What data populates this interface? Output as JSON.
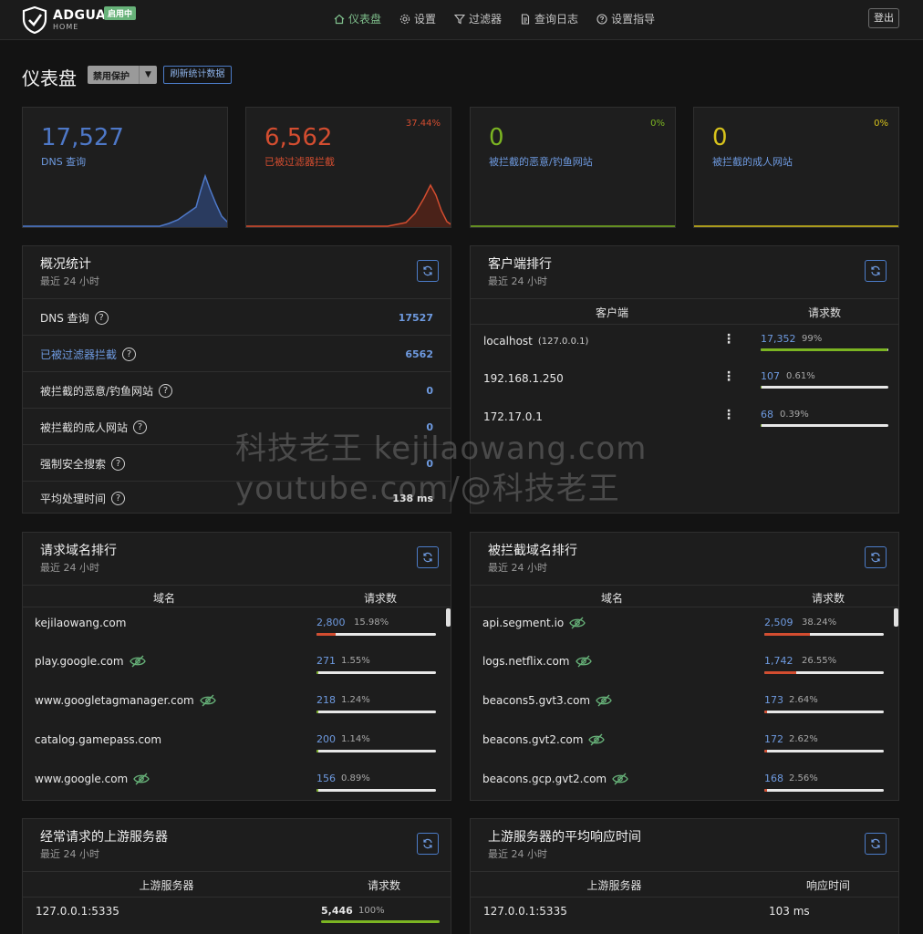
{
  "header": {
    "brand": "ADGUARD",
    "brand_sub": "HOME",
    "status_badge": "启用中",
    "nav": [
      {
        "label": "仪表盘",
        "icon": "home-icon"
      },
      {
        "label": "设置",
        "icon": "gear-icon"
      },
      {
        "label": "过滤器",
        "icon": "filter-icon"
      },
      {
        "label": "查询日志",
        "icon": "document-icon"
      },
      {
        "label": "设置指导",
        "icon": "help-icon"
      }
    ],
    "logout": "登出"
  },
  "page": {
    "title": "仪表盘",
    "toggle_protection": "禁用保护",
    "refresh_stats": "刷新统计数据"
  },
  "stats": [
    {
      "value": "17,527",
      "label": "DNS 查询",
      "percent": "",
      "color": "#4e78c8"
    },
    {
      "value": "6,562",
      "label": "已被过滤器拦截",
      "percent": "37.44%",
      "color": "#d34d30"
    },
    {
      "value": "0",
      "label": "被拦截的恶意/钓鱼网站",
      "percent": "0%",
      "color": "#7bb422"
    },
    {
      "value": "0",
      "label": "被拦截的成人网站",
      "percent": "0%",
      "color": "#d8c31c"
    }
  ],
  "overview": {
    "title": "概况统计",
    "subtitle": "最近 24 小时",
    "rows": [
      {
        "label": "DNS 查询",
        "value": "17527"
      },
      {
        "label": "已被过滤器拦截",
        "value": "6562"
      },
      {
        "label": "被拦截的恶意/钓鱼网站",
        "value": "0"
      },
      {
        "label": "被拦截的成人网站",
        "value": "0"
      },
      {
        "label": "强制安全搜索",
        "value": "0"
      },
      {
        "label": "平均处理时间",
        "value": "138 ms"
      }
    ]
  },
  "clients": {
    "title": "客户端排行",
    "subtitle": "最近 24 小时",
    "col_client": "客户端",
    "col_requests": "请求数",
    "rows": [
      {
        "name": "localhost",
        "ip": "(127.0.0.1)",
        "count": "17,352",
        "percent": "99%",
        "fill": 0.99,
        "color": "#7bb422"
      },
      {
        "name": "192.168.1.250",
        "ip": "",
        "count": "107",
        "percent": "0.61%",
        "fill": 0.0061,
        "color": "#7bb422"
      },
      {
        "name": "172.17.0.1",
        "ip": "",
        "count": "68",
        "percent": "0.39%",
        "fill": 0.0039,
        "color": "#7bb422"
      }
    ]
  },
  "top_domains": {
    "title": "请求域名排行",
    "subtitle": "最近 24 小时",
    "col_domain": "域名",
    "col_requests": "请求数",
    "rows": [
      {
        "name": "kejilaowang.com",
        "eye": false,
        "count": "2,800",
        "percent": "15.98%",
        "fill": 0.16,
        "color": "#d34d30"
      },
      {
        "name": "play.google.com",
        "eye": true,
        "count": "271",
        "percent": "1.55%",
        "fill": 0.0155,
        "color": "#7bb422"
      },
      {
        "name": "www.googletagmanager.com",
        "eye": true,
        "count": "218",
        "percent": "1.24%",
        "fill": 0.0124,
        "color": "#7bb422"
      },
      {
        "name": "catalog.gamepass.com",
        "eye": false,
        "count": "200",
        "percent": "1.14%",
        "fill": 0.0114,
        "color": "#7bb422"
      },
      {
        "name": "www.google.com",
        "eye": true,
        "count": "156",
        "percent": "0.89%",
        "fill": 0.0089,
        "color": "#7bb422"
      }
    ]
  },
  "blocked_domains": {
    "title": "被拦截域名排行",
    "subtitle": "最近 24 小时",
    "col_domain": "域名",
    "col_requests": "请求数",
    "rows": [
      {
        "name": "api.segment.io",
        "count": "2,509",
        "percent": "38.24%",
        "fill": 0.38,
        "color": "#d34d30"
      },
      {
        "name": "logs.netflix.com",
        "count": "1,742",
        "percent": "26.55%",
        "fill": 0.27,
        "color": "#d34d30"
      },
      {
        "name": "beacons5.gvt3.com",
        "count": "173",
        "percent": "2.64%",
        "fill": 0.0264,
        "color": "#d34d30"
      },
      {
        "name": "beacons.gvt2.com",
        "count": "172",
        "percent": "2.62%",
        "fill": 0.0262,
        "color": "#d34d30"
      },
      {
        "name": "beacons.gcp.gvt2.com",
        "count": "168",
        "percent": "2.56%",
        "fill": 0.0256,
        "color": "#d34d30"
      }
    ]
  },
  "upstreams": {
    "title": "经常请求的上游服务器",
    "subtitle": "最近 24 小时",
    "col_server": "上游服务器",
    "col_requests": "请求数",
    "rows": [
      {
        "name": "127.0.0.1:5335",
        "count": "5,446",
        "percent": "100%",
        "fill": 1.0,
        "color": "#7bb422"
      }
    ]
  },
  "upstream_times": {
    "title": "上游服务器的平均响应时间",
    "subtitle": "最近 24 小时",
    "col_server": "上游服务器",
    "col_time": "响应时间",
    "rows": [
      {
        "name": "127.0.0.1:5335",
        "time": "103 ms"
      }
    ]
  },
  "watermark": {
    "line1": "科技老王 kejilaowang.com",
    "line2": "youtube.com/@科技老王"
  }
}
